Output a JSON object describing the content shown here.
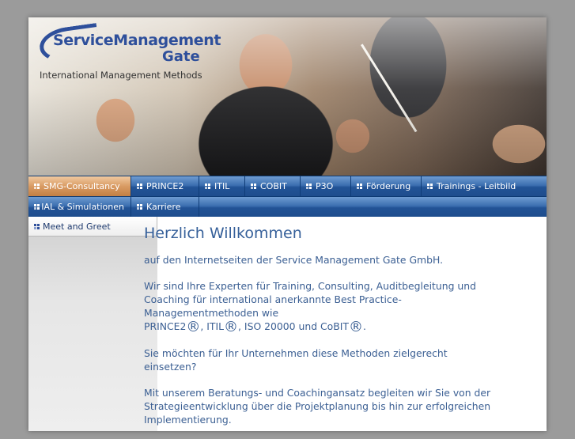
{
  "logo": {
    "line1": "ServiceManagement",
    "line2": "Gate",
    "tagline": "International Management Methods"
  },
  "nav": {
    "row1": [
      {
        "label": "SMG-Consultancy",
        "active": true
      },
      {
        "label": "PRINCE2",
        "active": false
      },
      {
        "label": "ITIL",
        "active": false
      },
      {
        "label": "COBIT",
        "active": false
      },
      {
        "label": "P3O",
        "active": false
      },
      {
        "label": "Förderung",
        "active": false
      },
      {
        "label": "Trainings - Leitbild",
        "active": false
      }
    ],
    "row2": [
      {
        "label": "IAL & Simulationen",
        "active": false
      },
      {
        "label": "Karriere",
        "active": false
      }
    ]
  },
  "sidebar": {
    "items": [
      {
        "label": "Meet and Greet"
      }
    ]
  },
  "content": {
    "title": "Herzlich Willkommen",
    "p1": "auf den Internetseiten der Service Management Gate GmbH.",
    "p2_start": "Wir sind Ihre Experten für Training, Consulting, Auditbegleitung und Coaching für international anerkannte Best Practice-Managementmethoden wie",
    "p2_prince": "PRINCE2",
    "p2_sep1": ", ITIL",
    "p2_sep2": ", ISO 20000 und CoBIT",
    "p2_end": ".",
    "reg_mark": "®",
    "p3": "Sie möchten für Ihr Unternehmen diese Methoden zielgerecht einsetzen?",
    "p4": "Mit unserem Beratungs- und Coachingansatz begleiten wir Sie von der Strategieentwicklung über die Projektplanung bis hin zur erfolgreichen Implementierung."
  },
  "colors": {
    "nav_blue": "#225396",
    "nav_active": "#d99b63",
    "text_blue": "#3b5f93",
    "logo_blue": "#2e4f9b"
  }
}
